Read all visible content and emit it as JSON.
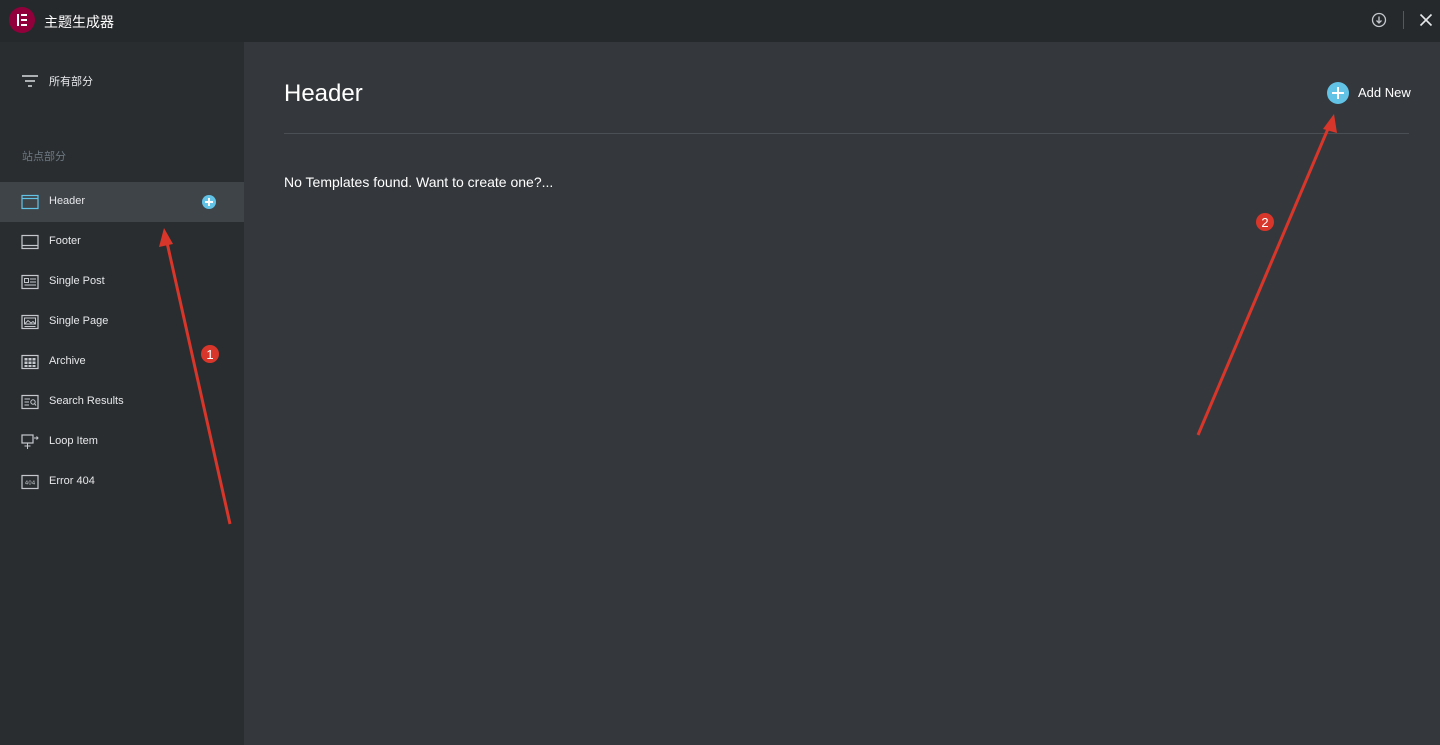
{
  "app": {
    "title": "主题生成器",
    "logo_icon": "elementor-logo-icon",
    "brand_color": "#92003b"
  },
  "toolbar": {
    "icons": [
      "download-icon",
      "close-icon"
    ]
  },
  "sidebar": {
    "filter_label": "所有部分",
    "filter_icon": "filter-lines-icon",
    "section_title": "站点部分",
    "active_item": "Header",
    "items": [
      {
        "label": "Header",
        "icon": "header-template-icon"
      },
      {
        "label": "Footer",
        "icon": "footer-template-icon"
      },
      {
        "label": "Single Post",
        "icon": "single-post-icon"
      },
      {
        "label": "Single Page",
        "icon": "single-page-icon"
      },
      {
        "label": "Archive",
        "icon": "archive-grid-icon"
      },
      {
        "label": "Search Results",
        "icon": "search-results-icon"
      },
      {
        "label": "Loop Item",
        "icon": "loop-item-icon"
      },
      {
        "label": "Error 404",
        "icon": "error-404-icon"
      }
    ]
  },
  "main": {
    "title": "Header",
    "add_new_label": "Add New",
    "empty_message": "No Templates found. Want to create one?..."
  },
  "annotations": {
    "badges": [
      "1",
      "2"
    ],
    "color": "#d8362a"
  },
  "colors": {
    "accent": "#62c3e7",
    "topbar_bg": "#26292c",
    "sidebar_bg": "#2a2d30",
    "main_bg": "#34383c",
    "active_item_bg": "#3f4449"
  }
}
